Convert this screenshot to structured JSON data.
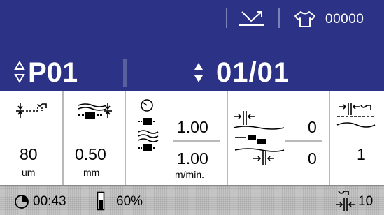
{
  "status_bar": {
    "piece_counter": "00000"
  },
  "program_bar": {
    "program": "P01",
    "step": "01/01"
  },
  "parameters": {
    "seam_length": {
      "value": "80",
      "unit": "um"
    },
    "feed": {
      "value": "0.50",
      "unit": "mm"
    },
    "speed": {
      "top_value": "1.00",
      "bottom_value": "1.00",
      "unit": "m/min."
    },
    "offset": {
      "top_value": "0",
      "bottom_value": "0"
    },
    "count": {
      "value": "1"
    }
  },
  "bottom_bar": {
    "timer": "00:43",
    "level_percent": "60%",
    "stitch_count": "10"
  },
  "colors": {
    "header_background": "#2c3387",
    "panel_background": "#ffffff",
    "bottom_background": "#c4c4c4"
  }
}
